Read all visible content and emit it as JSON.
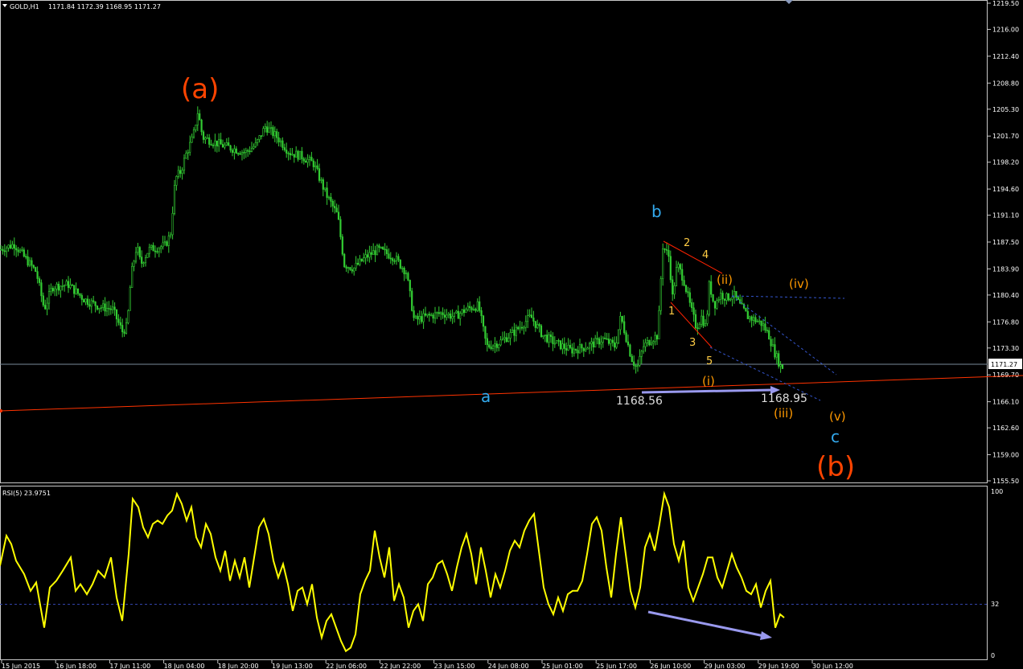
{
  "header": {
    "symbol_title": "GOLD,H1",
    "ohlc": "1171.84 1172.39 1168.95 1171.27"
  },
  "indicator": {
    "title": "RSI(5) 23.9751",
    "level": 32,
    "ylim": [
      0,
      100
    ],
    "labels": [
      "100",
      "32",
      "0"
    ]
  },
  "colors": {
    "background": "#000000",
    "candles": "#33cc33",
    "trend_line": "#ff3300",
    "rsi_line": "#ffff00",
    "divergence_arrow": "#9999ee",
    "grid_dots": "#3344aa",
    "wave_a": "#ff4400",
    "wave_minor": "#33aaee",
    "wave_sub": "#ff9900",
    "wave_micro": "#ffcc44"
  },
  "chart_data": [
    {
      "type": "candlestick",
      "symbol": "GOLD",
      "timeframe": "H1",
      "ylim": [
        1155.5,
        1219.5
      ],
      "y_ticks": [
        "1219.50",
        "1216.00",
        "1212.40",
        "1208.80",
        "1205.30",
        "1201.70",
        "1198.20",
        "1194.60",
        "1191.10",
        "1187.50",
        "1183.90",
        "1180.40",
        "1176.80",
        "1173.30",
        "1169.70",
        "1166.10",
        "1162.60",
        "1159.00",
        "1155.50"
      ],
      "x_ticks": [
        "15 Jun 2015",
        "16 Jun 18:00",
        "17 Jun 11:00",
        "18 Jun 04:00",
        "18 Jun 20:00",
        "19 Jun 13:00",
        "22 Jun 06:00",
        "22 Jun 22:00",
        "23 Jun 15:00",
        "24 Jun 08:00",
        "25 Jun 01:00",
        "25 Jun 17:00",
        "26 Jun 10:00",
        "29 Jun 03:00",
        "29 Jun 19:00",
        "30 Jun 12:00"
      ],
      "current_price": "1171.27",
      "price_path": [
        [
          0,
          1186.5
        ],
        [
          18,
          1187.2
        ],
        [
          30,
          1185.5
        ],
        [
          45,
          1183.5
        ],
        [
          55,
          1178.5
        ],
        [
          65,
          1181.5
        ],
        [
          85,
          1181.8
        ],
        [
          105,
          1179.8
        ],
        [
          125,
          1178.8
        ],
        [
          140,
          1178.5
        ],
        [
          152,
          1175.5
        ],
        [
          158,
          1176.2
        ],
        [
          163,
          1183.0
        ],
        [
          170,
          1187.0
        ],
        [
          175,
          1184.5
        ],
        [
          185,
          1186.5
        ],
        [
          205,
          1187.0
        ],
        [
          212,
          1188.5
        ],
        [
          218,
          1196.0
        ],
        [
          225,
          1197.0
        ],
        [
          232,
          1199.5
        ],
        [
          240,
          1201.5
        ],
        [
          246,
          1205.0
        ],
        [
          252,
          1201.5
        ],
        [
          260,
          1201.2
        ],
        [
          275,
          1200.5
        ],
        [
          290,
          1200.0
        ],
        [
          305,
          1199.5
        ],
        [
          318,
          1200.5
        ],
        [
          330,
          1203.0
        ],
        [
          345,
          1201.5
        ],
        [
          360,
          1199.5
        ],
        [
          375,
          1199.0
        ],
        [
          390,
          1198.0
        ],
        [
          405,
          1194.0
        ],
        [
          420,
          1191.0
        ],
        [
          428,
          1184.5
        ],
        [
          440,
          1184.0
        ],
        [
          455,
          1185.5
        ],
        [
          470,
          1186.5
        ],
        [
          490,
          1185.5
        ],
        [
          505,
          1183.5
        ],
        [
          515,
          1177.0
        ],
        [
          530,
          1177.5
        ],
        [
          550,
          1178.0
        ],
        [
          565,
          1177.5
        ],
        [
          580,
          1178.5
        ],
        [
          595,
          1179.0
        ],
        [
          605,
          1173.5
        ],
        [
          620,
          1174.0
        ],
        [
          640,
          1175.5
        ],
        [
          660,
          1177.5
        ],
        [
          675,
          1175.0
        ],
        [
          690,
          1174.0
        ],
        [
          710,
          1173.0
        ],
        [
          730,
          1173.5
        ],
        [
          750,
          1174.5
        ],
        [
          765,
          1173.5
        ],
        [
          772,
          1177.5
        ],
        [
          785,
          1172.0
        ],
        [
          792,
          1170.5
        ],
        [
          800,
          1173.5
        ],
        [
          810,
          1174.5
        ],
        [
          818,
          1175.0
        ],
        [
          824,
          1187.0
        ],
        [
          832,
          1185.5
        ],
        [
          836,
          1180.0
        ],
        [
          842,
          1184.5
        ],
        [
          850,
          1182.5
        ],
        [
          858,
          1179.0
        ],
        [
          866,
          1176.0
        ],
        [
          872,
          1177.5
        ],
        [
          878,
          1176.0
        ],
        [
          882,
          1182.0
        ],
        [
          888,
          1179.0
        ],
        [
          896,
          1180.5
        ],
        [
          904,
          1180.0
        ],
        [
          912,
          1180.5
        ],
        [
          920,
          1179.0
        ],
        [
          930,
          1177.5
        ],
        [
          940,
          1177.0
        ],
        [
          948,
          1176.5
        ],
        [
          956,
          1175.0
        ],
        [
          962,
          1173.0
        ],
        [
          968,
          1171.5
        ],
        [
          972,
          1170.5
        ],
        [
          975,
          1171.3
        ]
      ],
      "annotations": {
        "a_big": "(a)",
        "b_big": "(b)",
        "a": "a",
        "b": "b",
        "c": "c",
        "n1": "1",
        "n2": "2",
        "n3": "3",
        "n4": "4",
        "n5": "5",
        "i": "(i)",
        "ii": "(ii)",
        "iii": "(iii)",
        "iv": "(iv)",
        "v": "(v)",
        "low1": "1168.56",
        "low2": "1168.95"
      }
    },
    {
      "type": "line",
      "name": "RSI(5)",
      "ylim": [
        0,
        100
      ],
      "values": [
        [
          0,
          55
        ],
        [
          8,
          73
        ],
        [
          14,
          68
        ],
        [
          20,
          58
        ],
        [
          30,
          50
        ],
        [
          38,
          40
        ],
        [
          45,
          45
        ],
        [
          55,
          18
        ],
        [
          62,
          42
        ],
        [
          70,
          46
        ],
        [
          78,
          52
        ],
        [
          88,
          60
        ],
        [
          94,
          40
        ],
        [
          100,
          44
        ],
        [
          108,
          38
        ],
        [
          115,
          44
        ],
        [
          122,
          52
        ],
        [
          130,
          48
        ],
        [
          138,
          60
        ],
        [
          145,
          36
        ],
        [
          152,
          22
        ],
        [
          160,
          62
        ],
        [
          165,
          95
        ],
        [
          172,
          90
        ],
        [
          178,
          78
        ],
        [
          184,
          72
        ],
        [
          190,
          80
        ],
        [
          196,
          82
        ],
        [
          202,
          80
        ],
        [
          208,
          85
        ],
        [
          214,
          88
        ],
        [
          220,
          98
        ],
        [
          226,
          92
        ],
        [
          232,
          82
        ],
        [
          238,
          90
        ],
        [
          244,
          72
        ],
        [
          250,
          66
        ],
        [
          256,
          80
        ],
        [
          262,
          74
        ],
        [
          268,
          60
        ],
        [
          274,
          52
        ],
        [
          280,
          64
        ],
        [
          286,
          46
        ],
        [
          292,
          58
        ],
        [
          298,
          48
        ],
        [
          304,
          60
        ],
        [
          310,
          42
        ],
        [
          316,
          60
        ],
        [
          322,
          78
        ],
        [
          328,
          83
        ],
        [
          334,
          74
        ],
        [
          340,
          58
        ],
        [
          346,
          48
        ],
        [
          352,
          56
        ],
        [
          358,
          44
        ],
        [
          364,
          28
        ],
        [
          370,
          40
        ],
        [
          376,
          42
        ],
        [
          382,
          32
        ],
        [
          388,
          44
        ],
        [
          394,
          24
        ],
        [
          400,
          12
        ],
        [
          406,
          22
        ],
        [
          412,
          26
        ],
        [
          418,
          18
        ],
        [
          424,
          10
        ],
        [
          430,
          4
        ],
        [
          436,
          6
        ],
        [
          442,
          14
        ],
        [
          448,
          38
        ],
        [
          454,
          46
        ],
        [
          460,
          52
        ],
        [
          466,
          76
        ],
        [
          472,
          60
        ],
        [
          478,
          48
        ],
        [
          484,
          66
        ],
        [
          490,
          34
        ],
        [
          496,
          44
        ],
        [
          502,
          36
        ],
        [
          508,
          18
        ],
        [
          514,
          28
        ],
        [
          520,
          32
        ],
        [
          526,
          22
        ],
        [
          532,
          44
        ],
        [
          538,
          48
        ],
        [
          544,
          56
        ],
        [
          550,
          58
        ],
        [
          556,
          50
        ],
        [
          562,
          40
        ],
        [
          568,
          54
        ],
        [
          574,
          66
        ],
        [
          580,
          74
        ],
        [
          586,
          62
        ],
        [
          592,
          44
        ],
        [
          598,
          66
        ],
        [
          604,
          52
        ],
        [
          610,
          36
        ],
        [
          616,
          50
        ],
        [
          622,
          42
        ],
        [
          628,
          52
        ],
        [
          634,
          64
        ],
        [
          640,
          70
        ],
        [
          646,
          66
        ],
        [
          652,
          76
        ],
        [
          658,
          82
        ],
        [
          664,
          86
        ],
        [
          670,
          64
        ],
        [
          676,
          42
        ],
        [
          682,
          32
        ],
        [
          688,
          26
        ],
        [
          694,
          36
        ],
        [
          700,
          28
        ],
        [
          706,
          38
        ],
        [
          712,
          40
        ],
        [
          718,
          40
        ],
        [
          724,
          46
        ],
        [
          730,
          62
        ],
        [
          736,
          80
        ],
        [
          742,
          84
        ],
        [
          748,
          76
        ],
        [
          754,
          54
        ],
        [
          760,
          36
        ],
        [
          766,
          62
        ],
        [
          772,
          84
        ],
        [
          778,
          62
        ],
        [
          784,
          40
        ],
        [
          790,
          30
        ],
        [
          796,
          42
        ],
        [
          802,
          66
        ],
        [
          808,
          74
        ],
        [
          814,
          64
        ],
        [
          820,
          80
        ],
        [
          826,
          98
        ],
        [
          832,
          90
        ],
        [
          838,
          68
        ],
        [
          844,
          58
        ],
        [
          850,
          70
        ],
        [
          856,
          42
        ],
        [
          862,
          34
        ],
        [
          868,
          42
        ],
        [
          874,
          50
        ],
        [
          880,
          60
        ],
        [
          886,
          60
        ],
        [
          892,
          48
        ],
        [
          898,
          42
        ],
        [
          904,
          52
        ],
        [
          910,
          62
        ],
        [
          916,
          54
        ],
        [
          922,
          48
        ],
        [
          928,
          40
        ],
        [
          934,
          38
        ],
        [
          940,
          44
        ],
        [
          946,
          30
        ],
        [
          952,
          40
        ],
        [
          958,
          46
        ],
        [
          964,
          18
        ],
        [
          970,
          26
        ],
        [
          975,
          24
        ]
      ]
    }
  ]
}
